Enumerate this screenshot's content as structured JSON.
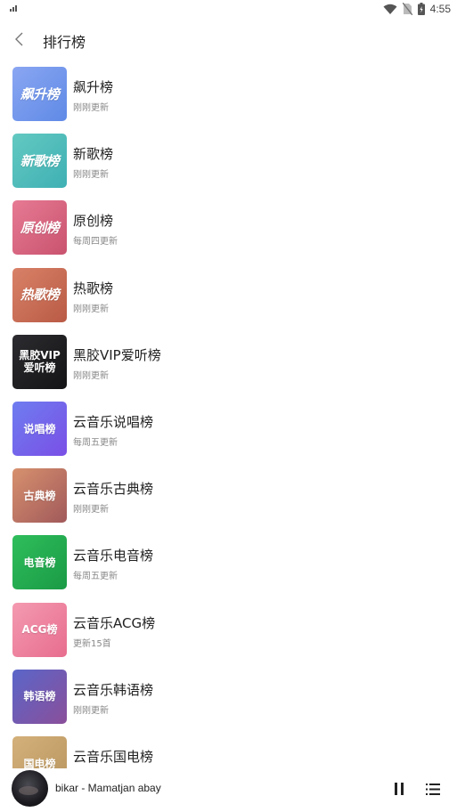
{
  "status_bar": {
    "time": "4:55"
  },
  "header": {
    "title": "排行榜"
  },
  "playlists": [
    {
      "title": "飙升榜",
      "subtitle": "刚刚更新",
      "cover_text": "飙升榜",
      "cover_colors": [
        "#8aa6f2",
        "#5f8ae6"
      ]
    },
    {
      "title": "新歌榜",
      "subtitle": "刚刚更新",
      "cover_text": "新歌榜",
      "cover_colors": [
        "#63c9c1",
        "#3fb0b4"
      ]
    },
    {
      "title": "原创榜",
      "subtitle": "每周四更新",
      "cover_text": "原创榜",
      "cover_colors": [
        "#e77a94",
        "#c9536f"
      ]
    },
    {
      "title": "热歌榜",
      "subtitle": "刚刚更新",
      "cover_text": "热歌榜",
      "cover_colors": [
        "#d98268",
        "#b95a45"
      ]
    },
    {
      "title": "黑胶VIP爱听榜",
      "subtitle": "刚刚更新",
      "cover_text": "黑胶VIP 爱听榜",
      "cover_colors": [
        "#2c2c30",
        "#141416"
      ]
    },
    {
      "title": "云音乐说唱榜",
      "subtitle": "每周五更新",
      "cover_text": "说唱榜",
      "cover_colors": [
        "#6e7df0",
        "#7a4fe6"
      ]
    },
    {
      "title": "云音乐古典榜",
      "subtitle": "刚刚更新",
      "cover_text": "古典榜",
      "cover_colors": [
        "#d7916e",
        "#a1595a"
      ]
    },
    {
      "title": "云音乐电音榜",
      "subtitle": "每周五更新",
      "cover_text": "电音榜",
      "cover_colors": [
        "#2fbe5c",
        "#1a9a45"
      ]
    },
    {
      "title": "云音乐ACG榜",
      "subtitle": "更新15首",
      "cover_text": "ACG榜",
      "cover_colors": [
        "#f49ab1",
        "#e76d8e"
      ]
    },
    {
      "title": "云音乐韩语榜",
      "subtitle": "刚刚更新",
      "cover_text": "韩语榜",
      "cover_colors": [
        "#5a66c9",
        "#8a4f9a"
      ]
    },
    {
      "title": "云音乐国电榜",
      "subtitle": "",
      "cover_text": "国电榜",
      "cover_colors": [
        "#d4b07a",
        "#b8955e"
      ]
    }
  ],
  "player": {
    "song": "bikar - Mamatjan abay"
  },
  "icons": {
    "back": "back-arrow-icon",
    "play_pause": "pause-icon",
    "queue": "playlist-icon",
    "wifi": "wifi-icon",
    "battery": "battery-icon"
  }
}
